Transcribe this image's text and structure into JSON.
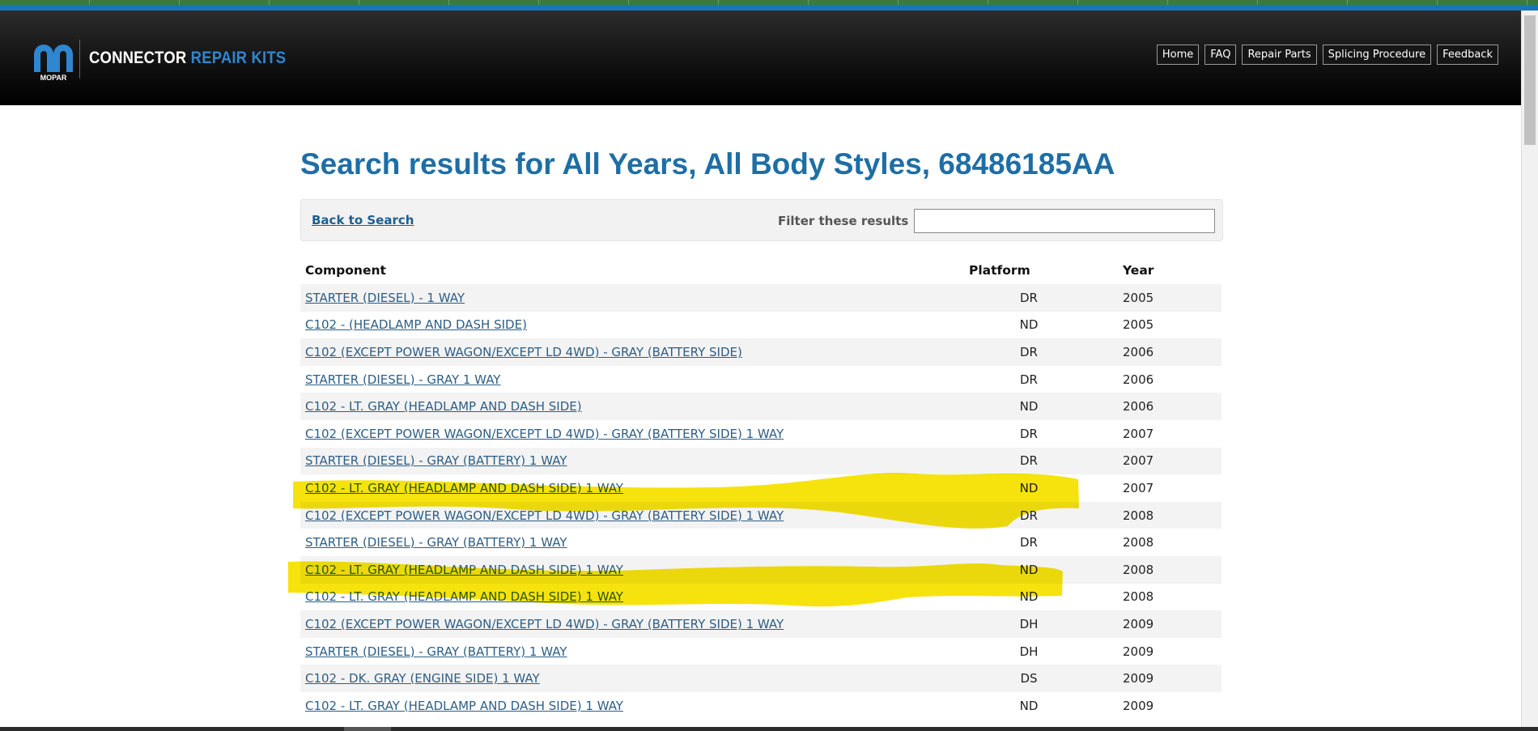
{
  "header": {
    "brand_white": "CONNECTOR",
    "brand_blue": "REPAIR KITS",
    "logo_text": "MOPAR",
    "nav": [
      "Home",
      "FAQ",
      "Repair Parts",
      "Splicing Procedure",
      "Feedback"
    ]
  },
  "main": {
    "title": "Search results for All Years, All Body Styles, 68486185AA",
    "back_link": "Back to Search",
    "filter_label": "Filter these results",
    "filter_value": ""
  },
  "table": {
    "headers": [
      "Component",
      "Platform",
      "Year"
    ],
    "rows": [
      {
        "component": "STARTER (DIESEL) - 1 WAY",
        "platform": "DR",
        "year": "2005"
      },
      {
        "component": "C102 - (HEADLAMP AND DASH SIDE)",
        "platform": "ND",
        "year": "2005"
      },
      {
        "component": "C102 (EXCEPT POWER WAGON/EXCEPT LD 4WD) - GRAY (BATTERY SIDE)",
        "platform": "DR",
        "year": "2006"
      },
      {
        "component": "STARTER (DIESEL) - GRAY 1 WAY",
        "platform": "DR",
        "year": "2006"
      },
      {
        "component": "C102 - LT. GRAY (HEADLAMP AND DASH SIDE)",
        "platform": "ND",
        "year": "2006"
      },
      {
        "component": "C102 (EXCEPT POWER WAGON/EXCEPT LD 4WD) - GRAY (BATTERY SIDE) 1 WAY",
        "platform": "DR",
        "year": "2007"
      },
      {
        "component": "STARTER (DIESEL) - GRAY (BATTERY) 1 WAY",
        "platform": "DR",
        "year": "2007"
      },
      {
        "component": "C102 - LT. GRAY (HEADLAMP AND DASH SIDE) 1 WAY",
        "platform": "ND",
        "year": "2007"
      },
      {
        "component": "C102 (EXCEPT POWER WAGON/EXCEPT LD 4WD) - GRAY (BATTERY SIDE) 1 WAY",
        "platform": "DR",
        "year": "2008"
      },
      {
        "component": "STARTER (DIESEL) - GRAY (BATTERY) 1 WAY",
        "platform": "DR",
        "year": "2008"
      },
      {
        "component": "C102 - LT. GRAY (HEADLAMP AND DASH SIDE) 1 WAY",
        "platform": "ND",
        "year": "2008"
      },
      {
        "component": "C102 - LT. GRAY (HEADLAMP AND DASH SIDE) 1 WAY",
        "platform": "ND",
        "year": "2008"
      },
      {
        "component": "C102 (EXCEPT POWER WAGON/EXCEPT LD 4WD) - GRAY (BATTERY SIDE) 1 WAY",
        "platform": "DH",
        "year": "2009"
      },
      {
        "component": "STARTER (DIESEL) - GRAY (BATTERY) 1 WAY",
        "platform": "DH",
        "year": "2009"
      },
      {
        "component": "C102 - DK. GRAY (ENGINE SIDE) 1 WAY",
        "platform": "DS",
        "year": "2009"
      },
      {
        "component": "C102 - LT. GRAY (HEADLAMP AND DASH SIDE) 1 WAY",
        "platform": "ND",
        "year": "2009"
      }
    ]
  },
  "highlight": {
    "color": "#f5e200",
    "rows": [
      8,
      11
    ]
  },
  "colors": {
    "title": "#1e6ea6",
    "link": "#2d5e86",
    "brand_blue": "#2f86d1"
  }
}
